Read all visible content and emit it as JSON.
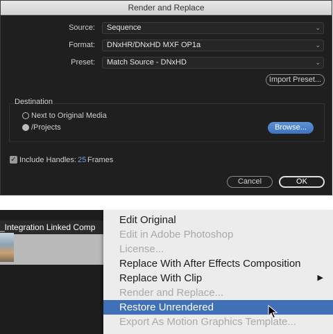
{
  "dialog": {
    "title": "Render and Replace",
    "source_label": "Source:",
    "source_value": "Sequence",
    "format_label": "Format:",
    "format_value": "DNxHR/DNxHD MXF OP1a",
    "preset_label": "Preset:",
    "preset_value": "Match Source - DNxHD",
    "import_preset": "Import Preset...",
    "destination_label": "Destination",
    "radio_next": "Next to Original Media",
    "radio_projects": "/Projects",
    "browse": "Browse...",
    "include_handles": "Include Handles:",
    "handles_value": "25",
    "handles_unit": "Frames",
    "cancel": "Cancel",
    "ok": "OK",
    "colors": {
      "accent": "#4d84cc",
      "background": "#1f1f1f"
    }
  },
  "clip": {
    "title": "_Integration Linked Comp"
  },
  "menu": {
    "items": [
      {
        "label": "Edit Original",
        "enabled": true
      },
      {
        "label": "Edit in Adobe Photoshop",
        "enabled": false
      },
      {
        "label": "License...",
        "enabled": false
      },
      {
        "label": "Replace With After Effects Composition",
        "enabled": true
      },
      {
        "label": "Replace With Clip",
        "enabled": true,
        "submenu": true
      },
      {
        "label": "Render and Replace...",
        "enabled": false
      },
      {
        "label": "Restore Unrendered",
        "enabled": true,
        "highlighted": true
      },
      {
        "label": "Export As Motion Graphics Template...",
        "enabled": false
      }
    ],
    "highlight_color": "#3f6fb6"
  }
}
